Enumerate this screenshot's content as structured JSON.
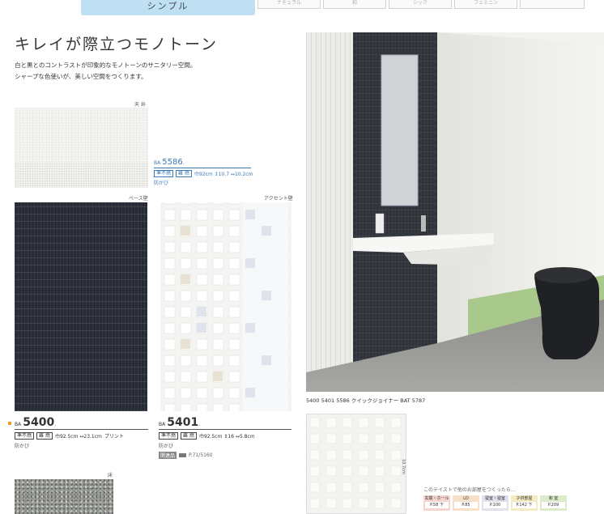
{
  "tabs": {
    "active": "シンプル",
    "others": [
      "ナチュラル",
      "和",
      "シック",
      "フェミニン",
      ""
    ]
  },
  "heading": "キレイが際立つモノトーン",
  "intro": {
    "line1": "白と黒とのコントラストが印象的なモノトーンのサニタリー空間。",
    "line2": "シャープな色使いが、美しい空間をつくります。"
  },
  "labels": {
    "ceiling": "天 井",
    "base_wall": "ベース壁",
    "accent_wall": "アクセント壁",
    "floor": "床"
  },
  "products": {
    "ceiling": {
      "prefix": "BA",
      "number": "5586",
      "suffix": ".",
      "tag1": "準不燃",
      "tag2": "難 燃",
      "specs": "巾92cm ↕10.7 ↔10.2cm",
      "note": "防かび"
    },
    "base": {
      "prefix": "BA",
      "number": "5400",
      "suffix": ".",
      "tag1": "準不燃",
      "tag2": "難 燃",
      "specs": "巾92.5cm ↔23.1cm",
      "extra": "プリント",
      "note": "防かび"
    },
    "accent": {
      "prefix": "BA",
      "number": "5401",
      "suffix": ".",
      "tag1": "準不燃",
      "tag2": "難 燃",
      "specs": "巾92.5cm ↕16 ↔5.8cm",
      "note": "防かび",
      "ref_badge": "関連品",
      "ref": "P.71/5160"
    }
  },
  "photo": {
    "caption": "5400  5401  5586  クイックジョイナー BAT 5787"
  },
  "new_swatch": {
    "dim": "10.7cm"
  },
  "rooms": {
    "title": "このテイストで他のお部屋をつくったら…",
    "items": [
      {
        "name": "玄関・ホール",
        "page": "P.58 下",
        "color": "#f6d4cf"
      },
      {
        "name": "LD",
        "page": "P.85",
        "color": "#f7e0c8"
      },
      {
        "name": "寝室・寝室",
        "page": "P.100",
        "color": "#e3e0ee"
      },
      {
        "name": "子供部屋",
        "page": "P.142 下",
        "color": "#f5ebc2"
      },
      {
        "name": "和 室",
        "page": "P.209",
        "color": "#dcebc9"
      }
    ]
  },
  "colors": {
    "tab_active": "#bfe0f2",
    "accent_blue": "#3a7ab8",
    "code_marker": "#f29a1d"
  }
}
